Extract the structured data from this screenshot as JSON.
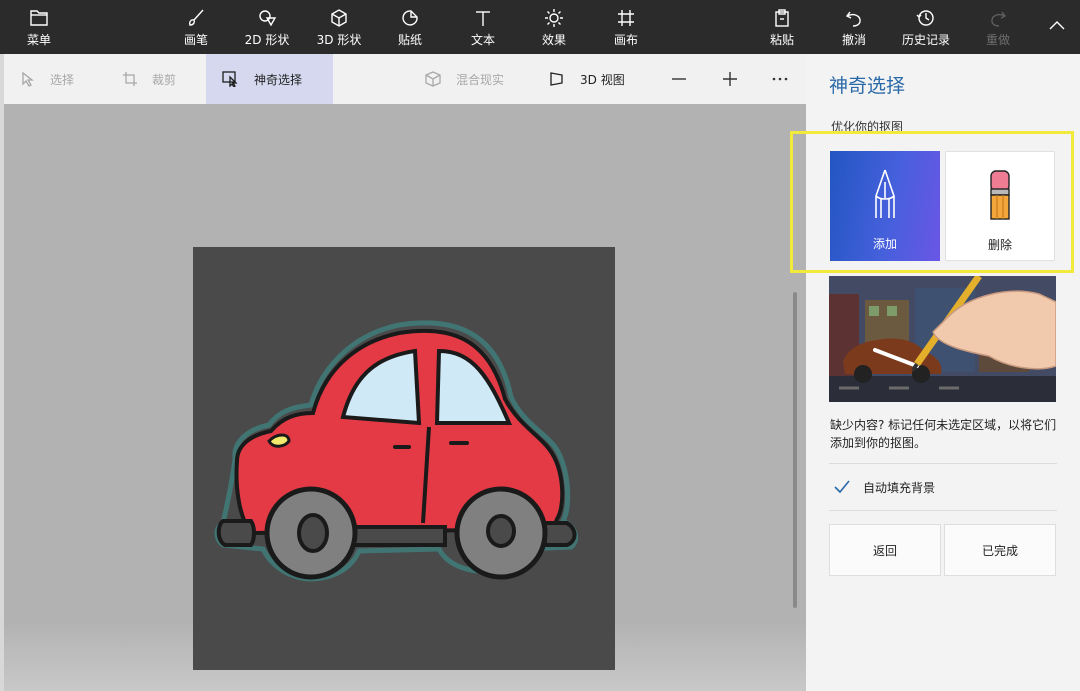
{
  "ribbon": {
    "menu": "菜单",
    "brushes": "画笔",
    "shapes2d": "2D 形状",
    "shapes3d": "3D 形状",
    "stickers": "贴纸",
    "text": "文本",
    "effects": "效果",
    "canvas": "画布",
    "paste": "粘贴",
    "undo": "撤消",
    "history": "历史记录",
    "redo": "重做"
  },
  "toolbar": {
    "select": "选择",
    "crop": "裁剪",
    "magic_select": "神奇选择",
    "mixed_reality": "混合现实",
    "view_3d": "3D 视图"
  },
  "panel": {
    "title": "神奇选择",
    "subtitle": "优化你的抠图",
    "add_label": "添加",
    "remove_label": "删除",
    "description": "缺少内容? 标记任何未选定区域，以将它们添加到你的抠图。",
    "autofill_label": "自动填充背景",
    "autofill_checked": true,
    "back_label": "返回",
    "done_label": "已完成"
  },
  "colors": {
    "ribbon_bg": "#2b2b2b",
    "accent_blue": "#2b6aa8",
    "highlight_yellow": "#f2ea3a",
    "add_gradient_start": "#2256c2",
    "add_gradient_end": "#6a56e6",
    "car_body": "#e43a45",
    "car_window": "#cfe9f7",
    "wheel": "#808080",
    "canvas_bg": "#4a4a4a"
  },
  "icons": {
    "menu": "folder-icon",
    "brushes": "brush-icon",
    "shapes2d": "shapes-2d-icon",
    "shapes3d": "cube-icon",
    "stickers": "sticker-icon",
    "text": "text-icon",
    "effects": "sun-icon",
    "canvas": "canvas-grid-icon",
    "paste": "clipboard-icon",
    "undo": "undo-icon",
    "history": "history-icon",
    "redo": "redo-icon",
    "collapse": "chevron-up-icon",
    "select": "cursor-icon",
    "crop": "crop-icon",
    "magic_select": "magic-select-icon",
    "mixed_reality": "mixed-reality-icon",
    "view_3d": "view-3d-icon",
    "zoom_out": "minus-icon",
    "zoom_in": "plus-icon",
    "more": "more-icon",
    "add": "pen-icon",
    "remove": "eraser-icon",
    "check": "checkmark-icon"
  }
}
